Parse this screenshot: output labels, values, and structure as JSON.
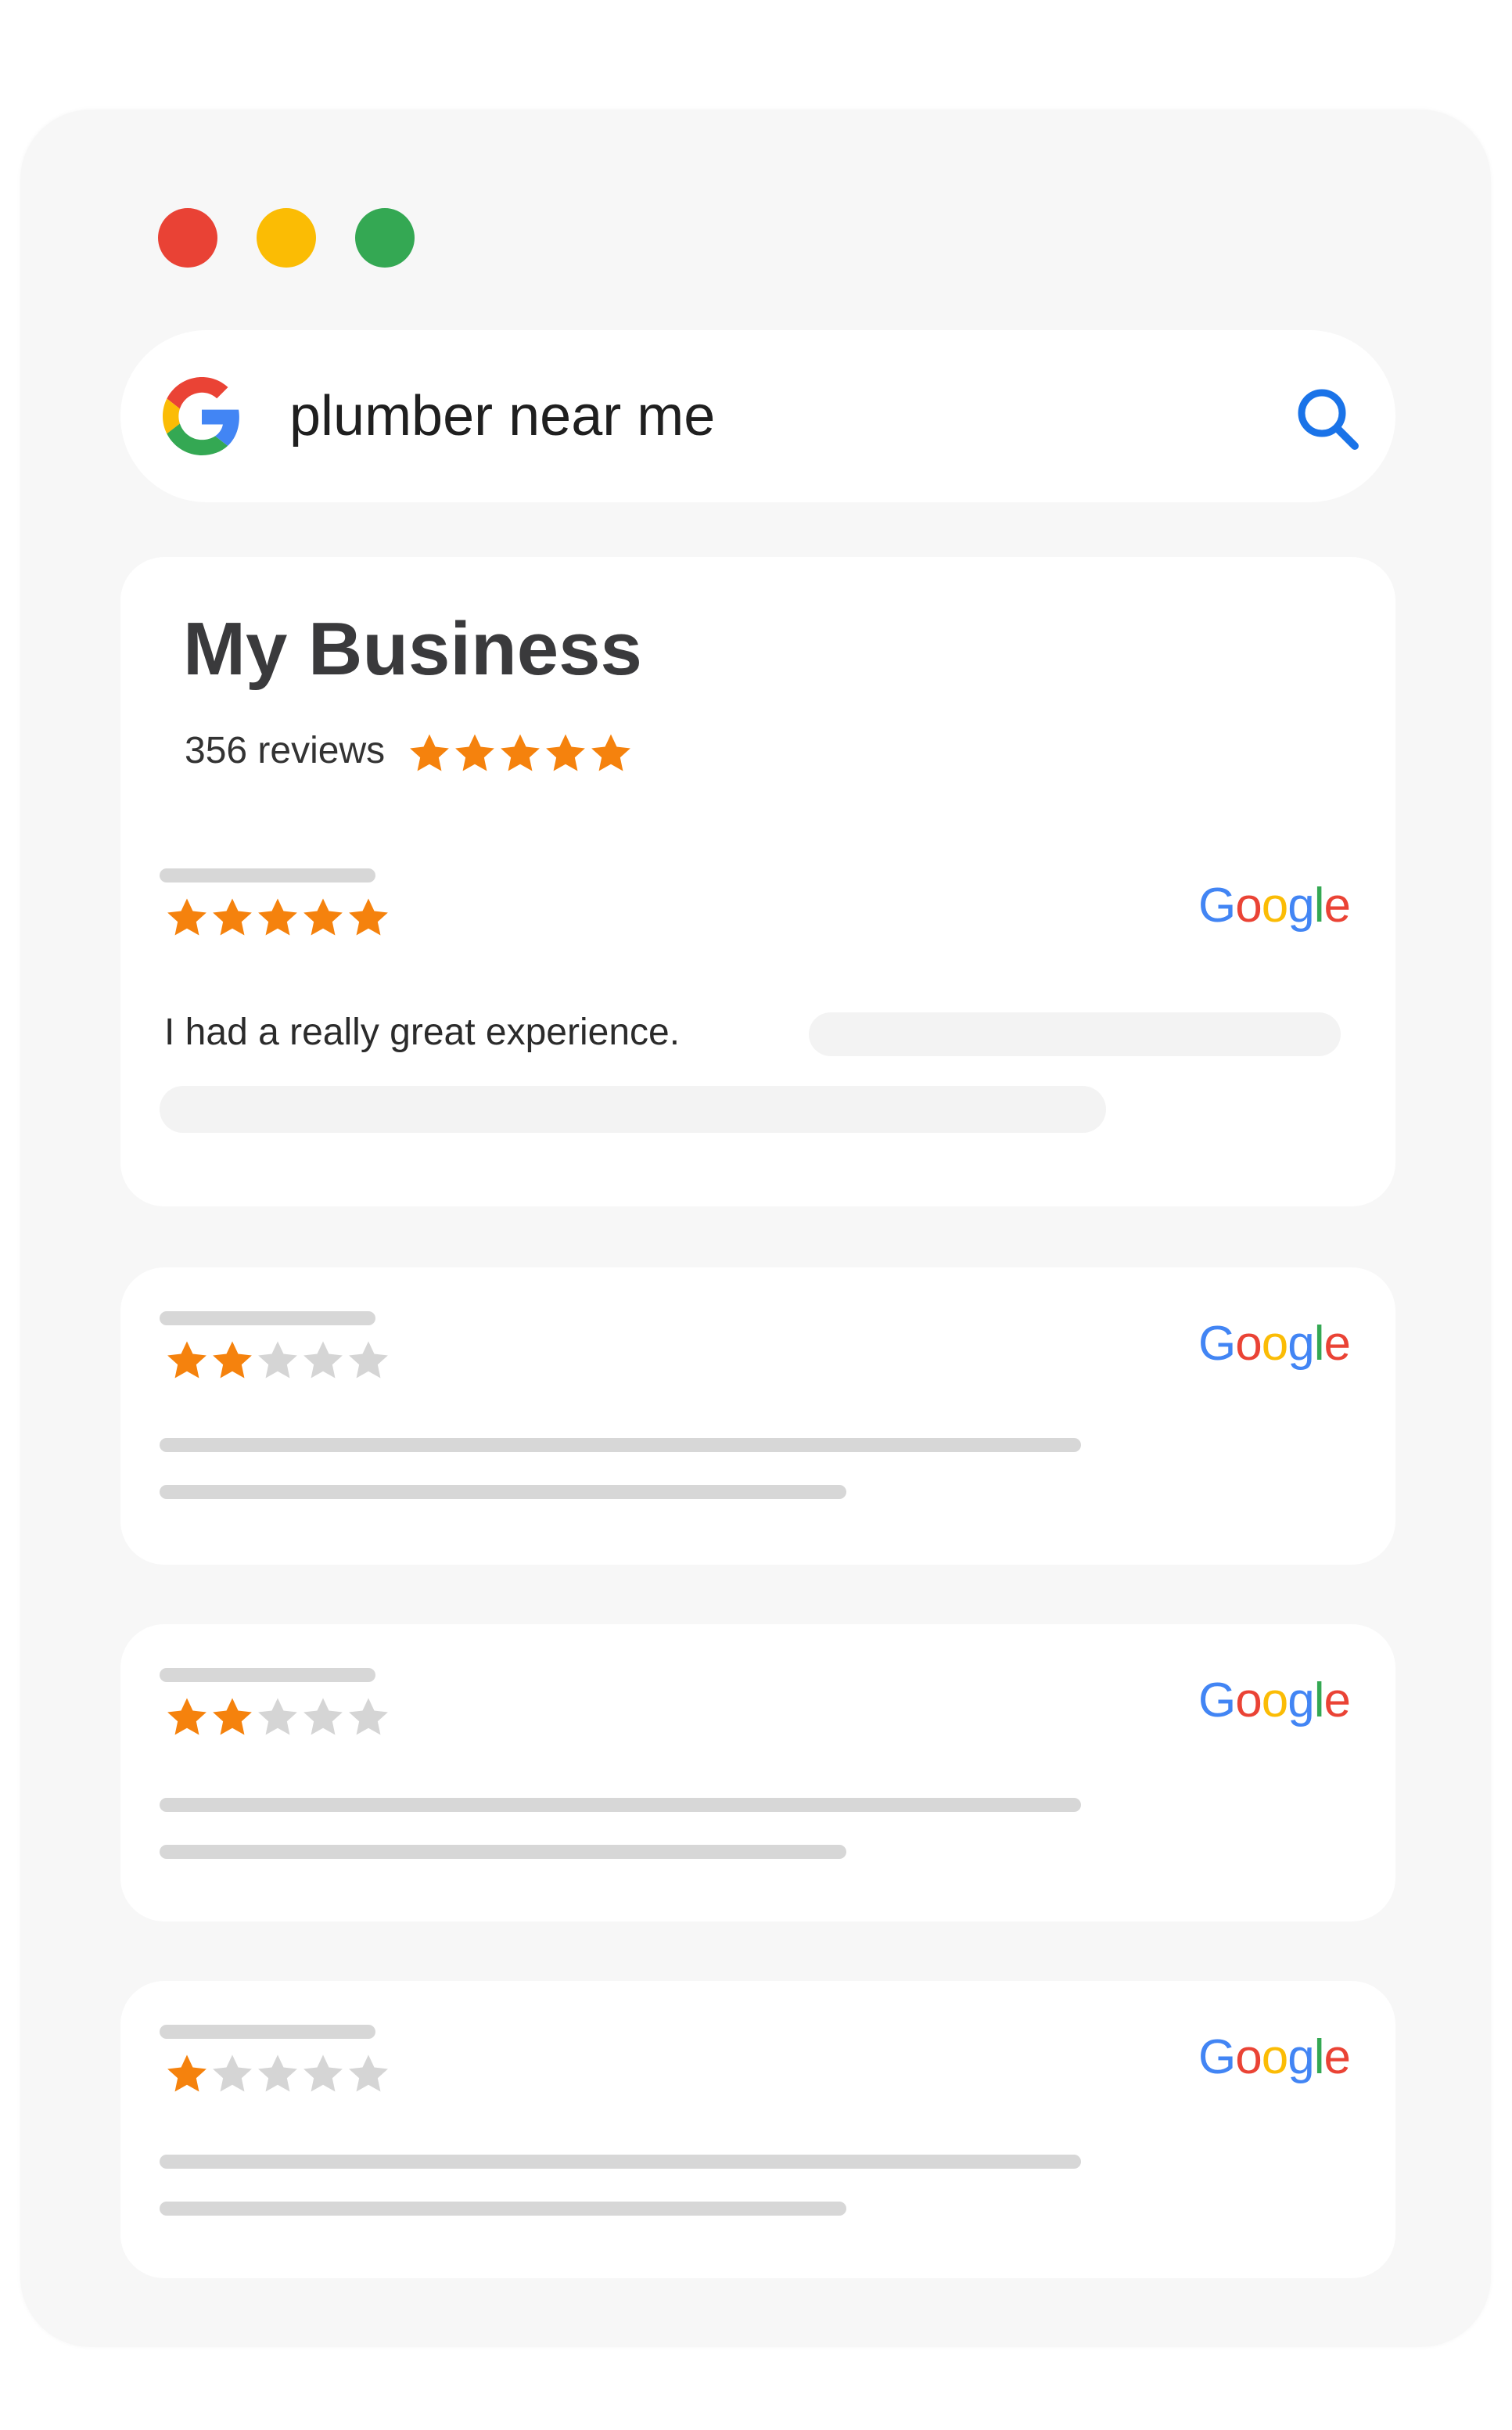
{
  "window": {
    "dots": [
      "close",
      "minimize",
      "maximize"
    ]
  },
  "search": {
    "query": "plumber near me",
    "logo_icon": "google-g-icon",
    "search_icon": "search-icon"
  },
  "business": {
    "name": "My Business",
    "review_count": "356 reviews",
    "rating_stars": 5
  },
  "reviews": [
    {
      "stars": 5,
      "source": "Google",
      "text": "I had a really great experience."
    },
    {
      "stars": 2,
      "source": "Google",
      "text": ""
    },
    {
      "stars": 2,
      "source": "Google",
      "text": ""
    },
    {
      "stars": 1,
      "source": "Google",
      "text": ""
    }
  ],
  "colors": {
    "star_filled": "#f5820d",
    "star_empty": "#d5d5d5",
    "dot_red": "#e94235",
    "dot_yellow": "#fbbc04",
    "dot_green": "#34a853",
    "search_icon": "#1a73e8"
  }
}
